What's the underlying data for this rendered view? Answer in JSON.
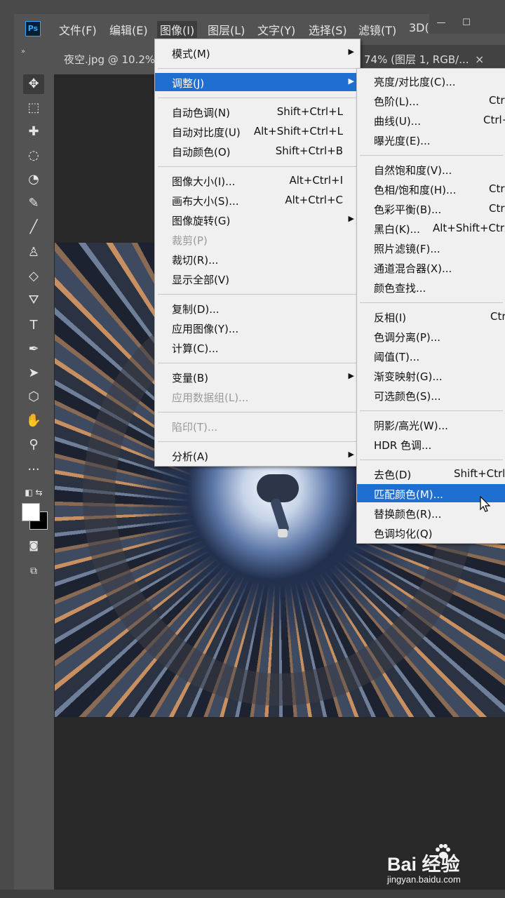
{
  "app": {
    "logo": "Ps"
  },
  "menubar": [
    {
      "label": "文件(F)",
      "active": false
    },
    {
      "label": "编辑(E)",
      "active": false
    },
    {
      "label": "图像(I)",
      "active": true
    },
    {
      "label": "图层(L)",
      "active": false
    },
    {
      "label": "文字(Y)",
      "active": false
    },
    {
      "label": "选择(S)",
      "active": false
    },
    {
      "label": "滤镜(T)",
      "active": false
    },
    {
      "label": "3D(",
      "active": false
    }
  ],
  "window_controls": {
    "minimize": "—",
    "maximize": "☐"
  },
  "tabs": {
    "doc1": "夜空.jpg @ 10.2%",
    "doc2": "74% (图层 1, RGB/...",
    "close": "×"
  },
  "tools": [
    "move-tool",
    "marquee-tool",
    "healing-tool",
    "lasso-tool",
    "quick-select-tool",
    "eyedropper-tool",
    "brush-tool",
    "stamp-tool",
    "eraser-tool",
    "paint-bucket-tool",
    "type-tool",
    "pen-tool",
    "path-select-tool",
    "shape-tool",
    "hand-tool",
    "zoom-tool",
    "more-tools"
  ],
  "image_menu": {
    "groups": [
      [
        {
          "label": "模式(M)",
          "shortcut": "",
          "submenu": true
        }
      ],
      [
        {
          "label": "调整(J)",
          "shortcut": "",
          "submenu": true,
          "highlight": true
        }
      ],
      [
        {
          "label": "自动色调(N)",
          "shortcut": "Shift+Ctrl+L"
        },
        {
          "label": "自动对比度(U)",
          "shortcut": "Alt+Shift+Ctrl+L"
        },
        {
          "label": "自动颜色(O)",
          "shortcut": "Shift+Ctrl+B"
        }
      ],
      [
        {
          "label": "图像大小(I)...",
          "shortcut": "Alt+Ctrl+I"
        },
        {
          "label": "画布大小(S)...",
          "shortcut": "Alt+Ctrl+C"
        },
        {
          "label": "图像旋转(G)",
          "shortcut": "",
          "submenu": true
        },
        {
          "label": "裁剪(P)",
          "shortcut": "",
          "disabled": true
        },
        {
          "label": "裁切(R)...",
          "shortcut": ""
        },
        {
          "label": "显示全部(V)",
          "shortcut": ""
        }
      ],
      [
        {
          "label": "复制(D)...",
          "shortcut": ""
        },
        {
          "label": "应用图像(Y)...",
          "shortcut": ""
        },
        {
          "label": "计算(C)...",
          "shortcut": ""
        }
      ],
      [
        {
          "label": "变量(B)",
          "shortcut": "",
          "submenu": true
        },
        {
          "label": "应用数据组(L)...",
          "shortcut": "",
          "disabled": true
        }
      ],
      [
        {
          "label": "陷印(T)...",
          "shortcut": "",
          "disabled": true
        }
      ],
      [
        {
          "label": "分析(A)",
          "shortcut": "",
          "submenu": true
        }
      ]
    ]
  },
  "adjust_menu": {
    "groups": [
      [
        {
          "label": "亮度/对比度(C)...",
          "shortcut": ""
        },
        {
          "label": "色阶(L)...",
          "shortcut": "Ctrl"
        },
        {
          "label": "曲线(U)...",
          "shortcut": "Ctrl+"
        },
        {
          "label": "曝光度(E)...",
          "shortcut": ""
        }
      ],
      [
        {
          "label": "自然饱和度(V)...",
          "shortcut": ""
        },
        {
          "label": "色相/饱和度(H)...",
          "shortcut": "Ctrl"
        },
        {
          "label": "色彩平衡(B)...",
          "shortcut": "Ctrl"
        },
        {
          "label": "黑白(K)...",
          "shortcut": "Alt+Shift+Ctrl"
        },
        {
          "label": "照片滤镜(F)...",
          "shortcut": ""
        },
        {
          "label": "通道混合器(X)...",
          "shortcut": ""
        },
        {
          "label": "颜色查找...",
          "shortcut": ""
        }
      ],
      [
        {
          "label": "反相(I)",
          "shortcut": "Ctr"
        },
        {
          "label": "色调分离(P)...",
          "shortcut": ""
        },
        {
          "label": "阈值(T)...",
          "shortcut": ""
        },
        {
          "label": "渐变映射(G)...",
          "shortcut": ""
        },
        {
          "label": "可选颜色(S)...",
          "shortcut": ""
        }
      ],
      [
        {
          "label": "阴影/高光(W)...",
          "shortcut": ""
        },
        {
          "label": "HDR 色调...",
          "shortcut": ""
        }
      ],
      [
        {
          "label": "去色(D)",
          "shortcut": "Shift+Ctrl"
        },
        {
          "label": "匹配颜色(M)...",
          "shortcut": "",
          "highlight": true
        },
        {
          "label": "替换颜色(R)...",
          "shortcut": ""
        },
        {
          "label": "色调均化(Q)",
          "shortcut": ""
        }
      ]
    ]
  },
  "watermark": {
    "brand": "Bai  经验",
    "url": "jingyan.baidu.com"
  },
  "colors": {
    "menu_highlight": "#1e6fd0",
    "menubar_bg": "#535353",
    "menu_bg": "#f0f0f0"
  }
}
